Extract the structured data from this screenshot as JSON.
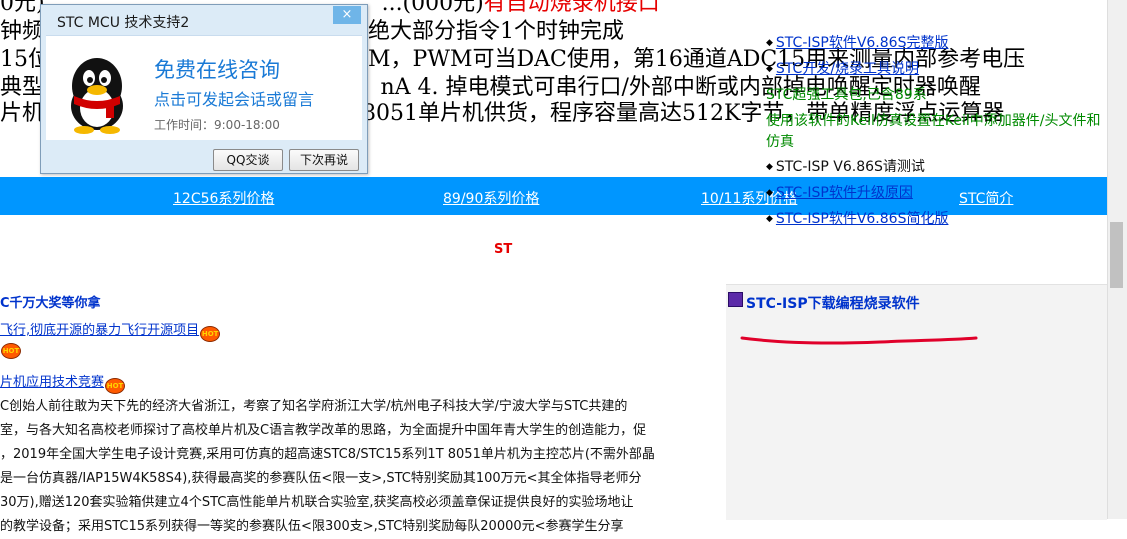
{
  "top_text": {
    "line0_prefix": "0元),",
    "line0_middle": "...(000元)",
    "line0_red": "有自动烧录机接口",
    "line1_a": "钟频",
    "line1_b": "绝大部分指令1个时钟完成",
    "line2_a": "15位",
    "line2_b": "M，PWM可当DAC使用，第16通道ADC15用来测量内部参考电压",
    "line3_a": "典型<",
    "line3_b": "nA   4. 掉电模式可串行口/外部中断或内部掉电唤醒定时器唤醒",
    "line4_a": "片机",
    "line4_b": "8051单片机供货，程序容量高达512K字节，带单精度浮点运算器"
  },
  "nav": {
    "items": [
      "12C56系列价格",
      "89/90系列价格",
      "10/11系列价格",
      "STC简介"
    ],
    "color": "#0096ff"
  },
  "logo_fragment": "ST",
  "left": {
    "heading": "C千万大奖等你拿",
    "link0": "飞行,彻底开源的暴力飞行开源项目",
    "link2": "片机应用技术竞赛",
    "hot_badge": "HOT",
    "paragraph": [
      "C创始人前往敢为天下先的经济大省浙江，考察了知名学府浙江大学/杭州电子科技大学/宁波大学与STC共建的",
      "室，与各大知名高校老师探讨了高校单片机及C语言教学改革的思路，为全面提升中国年青大学生的创造能力，促",
      "，2019年全国大学生电子设计竞赛,采用可仿真的超高速STC8/STC15系列1T 8051单片机为主控芯片(不需外部晶",
      "是一台仿真器/IAP15W4K58S4),获得最高奖的参赛队伍<限一支>,STC特别奖励其100万元<其全体指导老师分",
      "30万),赠送120套实验箱供建立4个STC高性能单片机联合实验室,获奖高校必须盖章保证提供良好的实验场地让",
      "的教学设备；采用STC15系列获得一等奖的参赛队伍<限300支>,STC特别奖励每队20000元<参赛学生分享"
    ]
  },
  "right_panel": {
    "title": "STC-ISP下载编程烧录软件",
    "items": [
      {
        "text": "STC-ISP软件V6.86S完整版",
        "kind": "link",
        "bullet": true
      },
      {
        "text": "STC开发/烧录工具说明",
        "kind": "link",
        "bullet": true
      },
      {
        "text": "STC超强工具包,已含89系",
        "kind": "green",
        "bullet": false
      },
      {
        "text": "使用该软件的Keil仿真设置在Keil中添加器件/头文件和仿真",
        "kind": "green",
        "bullet": false
      },
      {
        "text": "STC-ISP V6.86S请测试",
        "kind": "black",
        "bullet": true
      },
      {
        "text": "STC-ISP软件升级原因",
        "kind": "link",
        "bullet": true
      },
      {
        "text": "STC-ISP软件V6.86S简化版",
        "kind": "link",
        "bullet": true
      }
    ],
    "annotation_color": "#e0002a"
  },
  "qq_popup": {
    "title": "STC MCU 技术支持2",
    "close": "×",
    "headline": "免费在线咨询",
    "subline": "点击可发起会话或留言",
    "hours": "工作时间：9:00-18:00",
    "btn_chat": "QQ交谈",
    "btn_later": "下次再说",
    "avatar_icon": "qq-penguin-icon"
  }
}
